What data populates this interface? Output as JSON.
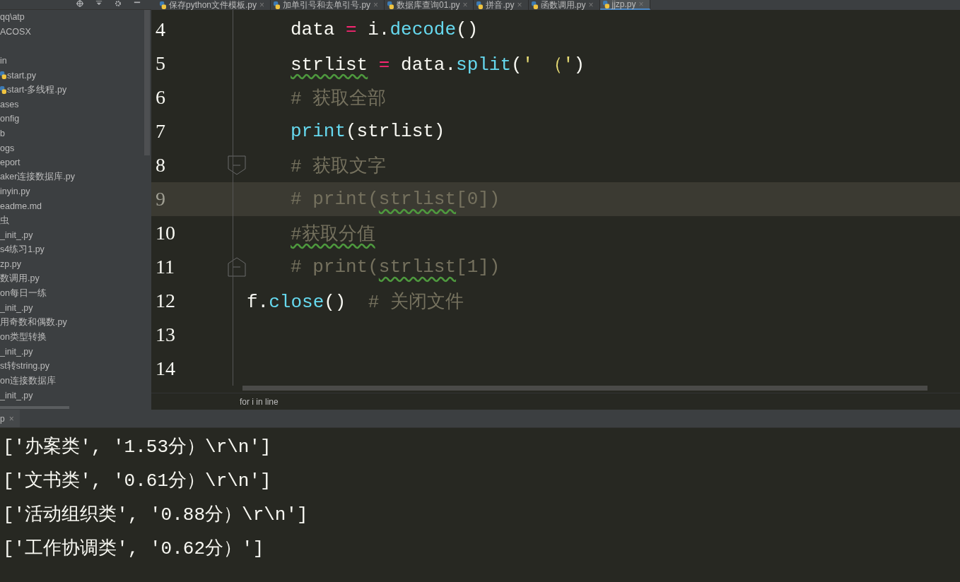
{
  "tabs": [
    {
      "label": "保存python文件模板.py",
      "close": "×",
      "selected": false
    },
    {
      "label": "加单引号和去单引号.py",
      "close": "×",
      "selected": false
    },
    {
      "label": "数据库查询01.py",
      "close": "×",
      "selected": false
    },
    {
      "label": "拼音.py",
      "close": "×",
      "selected": false
    },
    {
      "label": "函数调用.py",
      "close": "×",
      "selected": false
    },
    {
      "label": "jjzp.py",
      "close": "×",
      "selected": true
    }
  ],
  "tree": [
    {
      "label": "qq\\atp"
    },
    {
      "label": "ACOSX"
    },
    {
      "label": "in",
      "children": [
        {
          "label": "start.py",
          "kind": "python"
        },
        {
          "label": "start-多线程.py",
          "kind": "python"
        }
      ]
    },
    {
      "label": "ases"
    },
    {
      "label": "onfig"
    },
    {
      "label": "b"
    },
    {
      "label": "ogs"
    },
    {
      "label": "eport"
    },
    {
      "label": "aker连接数据库.py"
    },
    {
      "label": "inyin.py"
    },
    {
      "label": "eadme.md"
    },
    {
      "label": "虫"
    },
    {
      "label": "_init_.py"
    },
    {
      "label": "s4练习1.py"
    },
    {
      "label": "zp.py"
    },
    {
      "label": "数调用.py"
    },
    {
      "label": "on每日一练"
    },
    {
      "label": "_init_.py"
    },
    {
      "label": "用奇数和偶数.py"
    },
    {
      "label": "on类型转换"
    },
    {
      "label": "_init_.py"
    },
    {
      "label": "st转string.py"
    },
    {
      "label": "on连接数据库"
    },
    {
      "label": "_init_.py"
    }
  ],
  "code": [
    {
      "number": "4",
      "indented": true,
      "selected": false,
      "fold_start": false,
      "fold_end": false,
      "tokens": [
        {
          "kind": "plain",
          "text": "data "
        },
        {
          "kind": "op",
          "text": "="
        },
        {
          "kind": "plain",
          "text": " i."
        },
        {
          "kind": "func",
          "text": "decode"
        },
        {
          "kind": "plain",
          "text": "()"
        }
      ]
    },
    {
      "number": "5",
      "indented": true,
      "selected": false,
      "fold_start": false,
      "fold_end": false,
      "tokens": [
        {
          "kind": "typo",
          "text": "strlist"
        },
        {
          "kind": "op",
          "text": " = "
        },
        {
          "kind": "plain",
          "text": "data."
        },
        {
          "kind": "func",
          "text": "split"
        },
        {
          "kind": "plain",
          "text": "("
        },
        {
          "kind": "string",
          "text": "' （'"
        },
        {
          "kind": "plain",
          "text": ")"
        }
      ]
    },
    {
      "number": "6",
      "indented": true,
      "selected": false,
      "fold_start": false,
      "fold_end": false,
      "tokens": [
        {
          "kind": "comment",
          "text": "# 获取全部"
        }
      ]
    },
    {
      "number": "7",
      "indented": true,
      "selected": false,
      "fold_start": false,
      "fold_end": false,
      "tokens": [
        {
          "kind": "func",
          "text": "print"
        },
        {
          "kind": "plain",
          "text": "(strlist)"
        }
      ]
    },
    {
      "number": "8",
      "indented": true,
      "selected": false,
      "fold_start": true,
      "fold_end": false,
      "tokens": [
        {
          "kind": "comment",
          "text": "# 获取文字"
        }
      ]
    },
    {
      "number": "9",
      "indented": true,
      "selected": true,
      "fold_start": false,
      "fold_end": false,
      "tokens": [
        {
          "kind": "comment",
          "text": "# print("
        },
        {
          "kind": "comment-typo",
          "text": "strlist"
        },
        {
          "kind": "comment",
          "text": "[0])"
        }
      ]
    },
    {
      "number": "10",
      "indented": true,
      "selected": false,
      "fold_start": false,
      "fold_end": false,
      "tokens": [
        {
          "kind": "comment-typo",
          "text": "#获取分值"
        }
      ]
    },
    {
      "number": "11",
      "indented": true,
      "selected": false,
      "fold_start": false,
      "fold_end": true,
      "tokens": [
        {
          "kind": "comment",
          "text": "# print("
        },
        {
          "kind": "comment-typo",
          "text": "strlist"
        },
        {
          "kind": "comment",
          "text": "[1])"
        }
      ]
    },
    {
      "number": "12",
      "indented": false,
      "selected": false,
      "fold_start": false,
      "fold_end": false,
      "tokens": [
        {
          "kind": "plain",
          "text": "f."
        },
        {
          "kind": "func",
          "text": "close"
        },
        {
          "kind": "plain",
          "text": "()  "
        },
        {
          "kind": "comment",
          "text": "# 关闭文件"
        }
      ]
    },
    {
      "number": "13",
      "selected": false,
      "fold_start": false,
      "fold_end": false
    },
    {
      "number": "14",
      "selected": false,
      "fold_start": false,
      "fold_end": false
    }
  ],
  "breadcrumb": "for i in line",
  "run_tab": {
    "label": "p",
    "close": "×"
  },
  "output": [
    "['办案类', '1.53分）\\r\\n']",
    "['文书类', '0.61分）\\r\\n']",
    "['活动组织类', '0.88分）\\r\\n']",
    "['工作协调类', '0.62分）']"
  ]
}
